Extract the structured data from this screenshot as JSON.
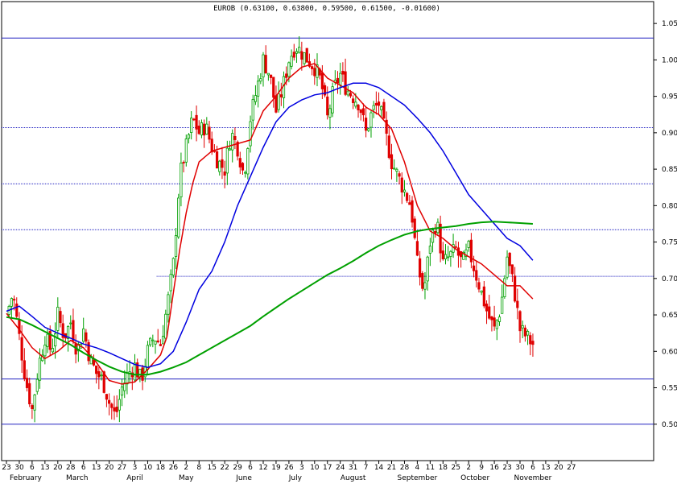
{
  "chart_data": {
    "type": "candlestick",
    "title": "EUROB (0.63100, 0.63800, 0.59500, 0.61500, -0.01600)",
    "ylim": [
      0.45,
      1.08
    ],
    "y_ticks": [
      "0.50",
      "0.55",
      "0.60",
      "0.65",
      "0.70",
      "0.75",
      "0.80",
      "0.85",
      "0.90",
      "0.95",
      "1.00",
      "1.05"
    ],
    "y_tick_values": [
      0.5,
      0.55,
      0.6,
      0.65,
      0.7,
      0.75,
      0.8,
      0.85,
      0.9,
      0.95,
      1.0,
      1.05
    ],
    "x_day_labels": [
      "23",
      "30",
      "6",
      "13",
      "20",
      "28",
      "6",
      "13",
      "20",
      "27",
      "3",
      "10",
      "18",
      "26",
      "2",
      "8",
      "15",
      "22",
      "29",
      "6",
      "12",
      "19",
      "26",
      "3",
      "10",
      "17",
      "24",
      "31",
      "7",
      "14",
      "21",
      "28",
      "4",
      "11",
      "18",
      "25",
      "2",
      "9",
      "16",
      "23",
      "30",
      "6",
      "13",
      "20",
      "27"
    ],
    "x_months": [
      {
        "label": "February",
        "day_index": 1.5
      },
      {
        "label": "March",
        "day_index": 5.5
      },
      {
        "label": "April",
        "day_index": 10
      },
      {
        "label": "May",
        "day_index": 14
      },
      {
        "label": "June",
        "day_index": 18.5
      },
      {
        "label": "July",
        "day_index": 22.5
      },
      {
        "label": "August",
        "day_index": 27
      },
      {
        "label": "September",
        "day_index": 32
      },
      {
        "label": "October",
        "day_index": 36.5
      },
      {
        "label": "November",
        "day_index": 41
      }
    ],
    "hlines": [
      {
        "value": 1.03,
        "color": "#2020c0",
        "style": "solid"
      },
      {
        "value": 0.907,
        "color": "#2020c0",
        "style": "dotted"
      },
      {
        "value": 0.83,
        "color": "#2020c0",
        "style": "dotted"
      },
      {
        "value": 0.767,
        "color": "#2020c0",
        "style": "dotted"
      },
      {
        "value": 0.703,
        "color": "#2020c0",
        "style": "dotted",
        "from_day_index": 11.7
      },
      {
        "value": 0.562,
        "color": "#2020c0",
        "style": "solid"
      },
      {
        "value": 0.5,
        "color": "#2020c0",
        "style": "solid"
      }
    ],
    "close_path": [
      [
        0,
        0.65
      ],
      [
        0.5,
        0.68
      ],
      [
        1,
        0.62
      ],
      [
        1.5,
        0.56
      ],
      [
        2,
        0.52
      ],
      [
        2.5,
        0.58
      ],
      [
        3,
        0.62
      ],
      [
        3.5,
        0.6
      ],
      [
        4,
        0.65
      ],
      [
        4.5,
        0.62
      ],
      [
        5,
        0.64
      ],
      [
        5.5,
        0.6
      ],
      [
        6,
        0.63
      ],
      [
        6.5,
        0.59
      ],
      [
        7,
        0.57
      ],
      [
        7.5,
        0.56
      ],
      [
        8,
        0.53
      ],
      [
        8.5,
        0.51
      ],
      [
        9,
        0.55
      ],
      [
        9.5,
        0.57
      ],
      [
        10,
        0.58
      ],
      [
        10.5,
        0.56
      ],
      [
        11,
        0.6
      ],
      [
        11.5,
        0.62
      ],
      [
        12,
        0.61
      ],
      [
        12.5,
        0.66
      ],
      [
        13,
        0.72
      ],
      [
        13.5,
        0.84
      ],
      [
        14,
        0.88
      ],
      [
        14.5,
        0.92
      ],
      [
        15,
        0.9
      ],
      [
        15.5,
        0.91
      ],
      [
        16,
        0.88
      ],
      [
        16.5,
        0.86
      ],
      [
        17,
        0.85
      ],
      [
        17.5,
        0.9
      ],
      [
        18,
        0.88
      ],
      [
        18.5,
        0.84
      ],
      [
        19,
        0.92
      ],
      [
        19.5,
        0.96
      ],
      [
        20,
        1.0
      ],
      [
        20.5,
        0.98
      ],
      [
        21,
        0.93
      ],
      [
        21.5,
        0.96
      ],
      [
        22,
        1.0
      ],
      [
        22.5,
        1.02
      ],
      [
        23,
        1.01
      ],
      [
        23.5,
        1.0
      ],
      [
        24,
        0.99
      ],
      [
        24.5,
        0.97
      ],
      [
        25,
        0.92
      ],
      [
        25.5,
        0.96
      ],
      [
        26,
        0.98
      ],
      [
        26.5,
        0.96
      ],
      [
        27,
        0.95
      ],
      [
        27.5,
        0.94
      ],
      [
        28,
        0.9
      ],
      [
        28.5,
        0.93
      ],
      [
        29,
        0.94
      ],
      [
        29.5,
        0.9
      ],
      [
        30,
        0.86
      ],
      [
        30.5,
        0.84
      ],
      [
        31,
        0.82
      ],
      [
        31.5,
        0.8
      ],
      [
        32,
        0.72
      ],
      [
        32.5,
        0.68
      ],
      [
        33,
        0.75
      ],
      [
        33.5,
        0.78
      ],
      [
        34,
        0.72
      ],
      [
        34.5,
        0.73
      ],
      [
        35,
        0.74
      ],
      [
        35.5,
        0.72
      ],
      [
        36,
        0.74
      ],
      [
        36.5,
        0.71
      ],
      [
        37,
        0.68
      ],
      [
        37.5,
        0.65
      ],
      [
        38,
        0.63
      ],
      [
        38.5,
        0.66
      ],
      [
        39,
        0.73
      ],
      [
        39.5,
        0.69
      ],
      [
        40,
        0.63
      ],
      [
        40.5,
        0.62
      ],
      [
        41,
        0.61
      ],
      [
        41.2,
        0.615
      ]
    ],
    "series": [
      {
        "name": "",
        "color": "#e00000",
        "points": [
          [
            0,
            0.652
          ],
          [
            1,
            0.63
          ],
          [
            2,
            0.605
          ],
          [
            3,
            0.59
          ],
          [
            4,
            0.6
          ],
          [
            5,
            0.615
          ],
          [
            6,
            0.605
          ],
          [
            7,
            0.585
          ],
          [
            8,
            0.56
          ],
          [
            9,
            0.555
          ],
          [
            10,
            0.558
          ],
          [
            11,
            0.575
          ],
          [
            12,
            0.595
          ],
          [
            12.5,
            0.62
          ],
          [
            13,
            0.68
          ],
          [
            13.5,
            0.74
          ],
          [
            14,
            0.79
          ],
          [
            14.5,
            0.83
          ],
          [
            15,
            0.86
          ],
          [
            16,
            0.875
          ],
          [
            17,
            0.88
          ],
          [
            18,
            0.885
          ],
          [
            19,
            0.89
          ],
          [
            20,
            0.93
          ],
          [
            21,
            0.95
          ],
          [
            22,
            0.975
          ],
          [
            23,
            0.99
          ],
          [
            24,
            0.995
          ],
          [
            25,
            0.975
          ],
          [
            26,
            0.965
          ],
          [
            27,
            0.955
          ],
          [
            28,
            0.935
          ],
          [
            29,
            0.925
          ],
          [
            30,
            0.905
          ],
          [
            31,
            0.86
          ],
          [
            32,
            0.8
          ],
          [
            33,
            0.765
          ],
          [
            34,
            0.755
          ],
          [
            35,
            0.74
          ],
          [
            36,
            0.73
          ],
          [
            37,
            0.72
          ],
          [
            38,
            0.705
          ],
          [
            39,
            0.69
          ],
          [
            40,
            0.69
          ],
          [
            41,
            0.672
          ]
        ]
      },
      {
        "name": "",
        "color": "#0000e0",
        "points": [
          [
            0,
            0.655
          ],
          [
            1,
            0.662
          ],
          [
            2,
            0.648
          ],
          [
            3,
            0.633
          ],
          [
            4,
            0.625
          ],
          [
            5,
            0.618
          ],
          [
            6,
            0.61
          ],
          [
            7,
            0.605
          ],
          [
            8,
            0.598
          ],
          [
            9,
            0.59
          ],
          [
            10,
            0.582
          ],
          [
            11,
            0.578
          ],
          [
            12,
            0.583
          ],
          [
            13,
            0.6
          ],
          [
            14,
            0.64
          ],
          [
            15,
            0.685
          ],
          [
            16,
            0.71
          ],
          [
            17,
            0.75
          ],
          [
            18,
            0.8
          ],
          [
            19,
            0.84
          ],
          [
            20,
            0.88
          ],
          [
            21,
            0.915
          ],
          [
            22,
            0.935
          ],
          [
            23,
            0.945
          ],
          [
            24,
            0.952
          ],
          [
            25,
            0.955
          ],
          [
            26,
            0.962
          ],
          [
            27,
            0.968
          ],
          [
            28,
            0.968
          ],
          [
            29,
            0.962
          ],
          [
            30,
            0.95
          ],
          [
            31,
            0.938
          ],
          [
            32,
            0.92
          ],
          [
            33,
            0.9
          ],
          [
            34,
            0.875
          ],
          [
            35,
            0.845
          ],
          [
            36,
            0.815
          ],
          [
            37,
            0.795
          ],
          [
            38,
            0.775
          ],
          [
            39,
            0.755
          ],
          [
            40,
            0.745
          ],
          [
            41,
            0.725
          ]
        ]
      },
      {
        "name": "",
        "color": "#00a000",
        "points": [
          [
            0,
            0.647
          ],
          [
            1,
            0.644
          ],
          [
            2,
            0.636
          ],
          [
            3,
            0.627
          ],
          [
            4,
            0.618
          ],
          [
            5,
            0.609
          ],
          [
            6,
            0.598
          ],
          [
            7,
            0.588
          ],
          [
            8,
            0.579
          ],
          [
            9,
            0.572
          ],
          [
            10,
            0.568
          ],
          [
            11,
            0.568
          ],
          [
            12,
            0.572
          ],
          [
            13,
            0.578
          ],
          [
            14,
            0.585
          ],
          [
            15,
            0.595
          ],
          [
            16,
            0.605
          ],
          [
            17,
            0.615
          ],
          [
            18,
            0.625
          ],
          [
            19,
            0.635
          ],
          [
            20,
            0.648
          ],
          [
            21,
            0.66
          ],
          [
            22,
            0.672
          ],
          [
            23,
            0.683
          ],
          [
            24,
            0.694
          ],
          [
            25,
            0.705
          ],
          [
            26,
            0.714
          ],
          [
            27,
            0.724
          ],
          [
            28,
            0.735
          ],
          [
            29,
            0.745
          ],
          [
            30,
            0.753
          ],
          [
            31,
            0.76
          ],
          [
            32,
            0.765
          ],
          [
            33,
            0.768
          ],
          [
            34,
            0.77
          ],
          [
            35,
            0.772
          ],
          [
            36,
            0.775
          ],
          [
            37,
            0.777
          ],
          [
            38,
            0.778
          ],
          [
            39,
            0.777
          ],
          [
            40,
            0.776
          ],
          [
            41,
            0.775
          ]
        ]
      }
    ]
  }
}
